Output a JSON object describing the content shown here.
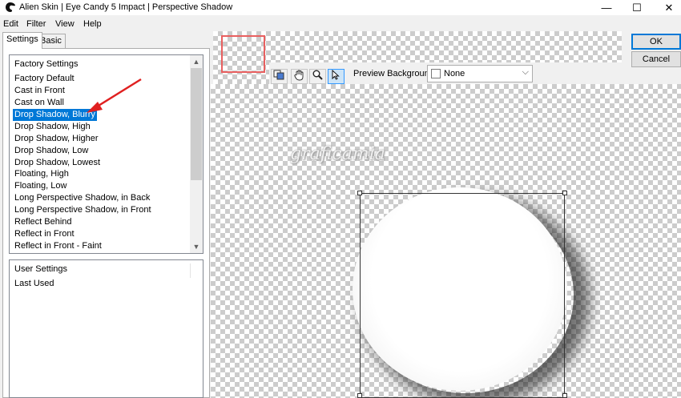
{
  "window": {
    "title": "Alien Skin | Eye Candy 5 Impact | Perspective Shadow",
    "minimize_glyph": "—",
    "maximize_glyph": "☐",
    "close_glyph": "✕"
  },
  "menu": {
    "items": [
      "Edit",
      "Filter",
      "View",
      "Help"
    ]
  },
  "tabs": [
    {
      "label": "Settings",
      "active": true
    },
    {
      "label": "Basic",
      "active": false
    }
  ],
  "factory_settings": {
    "header": "Factory Settings",
    "items": [
      "Factory Default",
      "Cast in Front",
      "Cast on Wall",
      "Drop Shadow, Blurry",
      "Drop Shadow, High",
      "Drop Shadow, Higher",
      "Drop Shadow, Low",
      "Drop Shadow, Lowest",
      "Floating, High",
      "Floating, Low",
      "Long Perspective Shadow, in Back",
      "Long Perspective Shadow, in Front",
      "Reflect Behind",
      "Reflect in Front",
      "Reflect in Front - Faint"
    ],
    "selected_index": 3
  },
  "user_settings": {
    "header": "User Settings",
    "items": [
      "Last Used"
    ]
  },
  "toolbar": {
    "preview_background_label": "Preview Background:",
    "preview_background_value": "None"
  },
  "buttons": {
    "ok": "OK",
    "cancel": "Cancel"
  },
  "watermark": "graficamia",
  "colors": {
    "selection": "#0078d7",
    "annotation_arrow": "#e02020",
    "thumbnail_border": "#e86060"
  }
}
